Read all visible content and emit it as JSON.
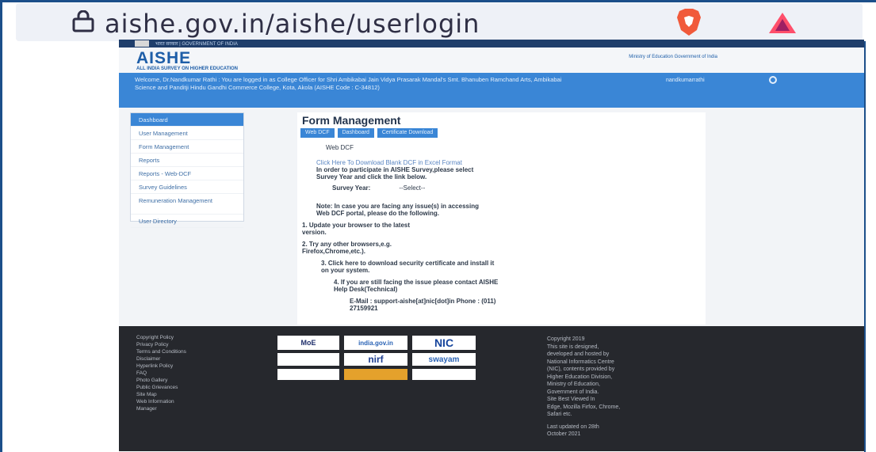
{
  "browser": {
    "url": "aishe.gov.in/aishe/userlogin"
  },
  "site": {
    "gov_strip": "भारत सरकार | GOVERNMENT OF INDIA",
    "logo_title": "AISHE",
    "logo_subtitle": "ALL INDIA SURVEY ON HIGHER EDUCATION",
    "header_right": "Ministry of Education Government of India",
    "welcome": "Welcome, Dr.Nandkumar Rathi : You are logged in as College Officer for Shri Ambikabai Jain Vidya Prasarak Mandal's Smt. Bhanuben Ramchand Arts, Ambikabai Science and Panditji Hindu Gandhi Commerce College, Kota, Akola (AISHE Code : C-34812)",
    "user_link": "nandkumarrathi"
  },
  "sidebar": {
    "items": [
      {
        "label": "Dashboard"
      },
      {
        "label": "User Management"
      },
      {
        "label": "Form Management"
      },
      {
        "label": "Reports"
      },
      {
        "label": "Reports - Web-DCF"
      },
      {
        "label": "Survey Guidelines"
      },
      {
        "label": "Remuneration Management"
      },
      {
        "label": "User Directory"
      }
    ]
  },
  "main": {
    "title": "Form Management",
    "tabs": [
      {
        "label": "Web DCF"
      },
      {
        "label": "Dashboard"
      },
      {
        "label": "Certificate Download"
      }
    ],
    "section_label": "Web DCF",
    "download_link": "Click Here To Download Blank DCF in Excel Format",
    "instruction_1": "In order to participate in AISHE Survey,please select",
    "instruction_2": "Survey Year and click the link below.",
    "survey_year_label": "Survey Year:",
    "survey_year_value": "--Select--",
    "note_1": "Note: In case you are facing any issue(s) in accessing",
    "note_2": "Web DCF portal, please do the following.",
    "step_1a": "1.  Update your browser to the latest",
    "step_1b": "version.",
    "step_2a": "2.  Try any other browsers,e.g.",
    "step_2b": "Firefox,Chrome,etc.).",
    "step_3a": "3. Click here to download security certificate and install it",
    "step_3b": "on your system.",
    "step_4a": "4. If you are still facing the issue please contact AISHE",
    "step_4b": "Help Desk(Technical)",
    "email_1": "E-Mail : support-aishe[at]nic[dot]in Phone : (011)",
    "email_2": "27159921"
  },
  "footer": {
    "links": [
      "Copyright Policy",
      "Privacy Policy",
      "Terms and Conditions",
      "Disclaimer",
      "Hyperlink Policy",
      "FAQ",
      "Photo Gallery",
      "Public Grievances",
      "Site Map",
      "Web Information",
      "Manager"
    ],
    "logos": [
      "MoE",
      "india.gov.in",
      "NIC",
      "nirf",
      "swayam"
    ],
    "copyright_lines": [
      "Copyright 2019",
      "This site is designed,",
      "developed and hosted by",
      "National Informatics Centre",
      "(NIC), contents provided by",
      "Higher Education Division,",
      "Ministry of Education,",
      "Government of India.",
      "Site Best Viewed In",
      "Edge, Mozilla Firfox, Chrome,",
      "Safari etc."
    ],
    "updated_1": "Last updated on 28th",
    "updated_2": "October 2021"
  }
}
